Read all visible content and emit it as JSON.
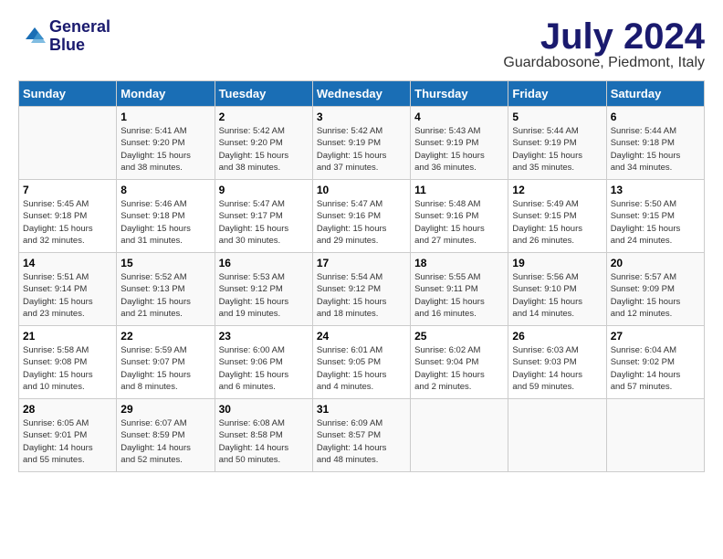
{
  "header": {
    "logo_line1": "General",
    "logo_line2": "Blue",
    "month_year": "July 2024",
    "location": "Guardabosone, Piedmont, Italy"
  },
  "days_of_week": [
    "Sunday",
    "Monday",
    "Tuesday",
    "Wednesday",
    "Thursday",
    "Friday",
    "Saturday"
  ],
  "weeks": [
    [
      {
        "day": "",
        "info": ""
      },
      {
        "day": "1",
        "info": "Sunrise: 5:41 AM\nSunset: 9:20 PM\nDaylight: 15 hours\nand 38 minutes."
      },
      {
        "day": "2",
        "info": "Sunrise: 5:42 AM\nSunset: 9:20 PM\nDaylight: 15 hours\nand 38 minutes."
      },
      {
        "day": "3",
        "info": "Sunrise: 5:42 AM\nSunset: 9:19 PM\nDaylight: 15 hours\nand 37 minutes."
      },
      {
        "day": "4",
        "info": "Sunrise: 5:43 AM\nSunset: 9:19 PM\nDaylight: 15 hours\nand 36 minutes."
      },
      {
        "day": "5",
        "info": "Sunrise: 5:44 AM\nSunset: 9:19 PM\nDaylight: 15 hours\nand 35 minutes."
      },
      {
        "day": "6",
        "info": "Sunrise: 5:44 AM\nSunset: 9:18 PM\nDaylight: 15 hours\nand 34 minutes."
      }
    ],
    [
      {
        "day": "7",
        "info": "Sunrise: 5:45 AM\nSunset: 9:18 PM\nDaylight: 15 hours\nand 32 minutes."
      },
      {
        "day": "8",
        "info": "Sunrise: 5:46 AM\nSunset: 9:18 PM\nDaylight: 15 hours\nand 31 minutes."
      },
      {
        "day": "9",
        "info": "Sunrise: 5:47 AM\nSunset: 9:17 PM\nDaylight: 15 hours\nand 30 minutes."
      },
      {
        "day": "10",
        "info": "Sunrise: 5:47 AM\nSunset: 9:16 PM\nDaylight: 15 hours\nand 29 minutes."
      },
      {
        "day": "11",
        "info": "Sunrise: 5:48 AM\nSunset: 9:16 PM\nDaylight: 15 hours\nand 27 minutes."
      },
      {
        "day": "12",
        "info": "Sunrise: 5:49 AM\nSunset: 9:15 PM\nDaylight: 15 hours\nand 26 minutes."
      },
      {
        "day": "13",
        "info": "Sunrise: 5:50 AM\nSunset: 9:15 PM\nDaylight: 15 hours\nand 24 minutes."
      }
    ],
    [
      {
        "day": "14",
        "info": "Sunrise: 5:51 AM\nSunset: 9:14 PM\nDaylight: 15 hours\nand 23 minutes."
      },
      {
        "day": "15",
        "info": "Sunrise: 5:52 AM\nSunset: 9:13 PM\nDaylight: 15 hours\nand 21 minutes."
      },
      {
        "day": "16",
        "info": "Sunrise: 5:53 AM\nSunset: 9:12 PM\nDaylight: 15 hours\nand 19 minutes."
      },
      {
        "day": "17",
        "info": "Sunrise: 5:54 AM\nSunset: 9:12 PM\nDaylight: 15 hours\nand 18 minutes."
      },
      {
        "day": "18",
        "info": "Sunrise: 5:55 AM\nSunset: 9:11 PM\nDaylight: 15 hours\nand 16 minutes."
      },
      {
        "day": "19",
        "info": "Sunrise: 5:56 AM\nSunset: 9:10 PM\nDaylight: 15 hours\nand 14 minutes."
      },
      {
        "day": "20",
        "info": "Sunrise: 5:57 AM\nSunset: 9:09 PM\nDaylight: 15 hours\nand 12 minutes."
      }
    ],
    [
      {
        "day": "21",
        "info": "Sunrise: 5:58 AM\nSunset: 9:08 PM\nDaylight: 15 hours\nand 10 minutes."
      },
      {
        "day": "22",
        "info": "Sunrise: 5:59 AM\nSunset: 9:07 PM\nDaylight: 15 hours\nand 8 minutes."
      },
      {
        "day": "23",
        "info": "Sunrise: 6:00 AM\nSunset: 9:06 PM\nDaylight: 15 hours\nand 6 minutes."
      },
      {
        "day": "24",
        "info": "Sunrise: 6:01 AM\nSunset: 9:05 PM\nDaylight: 15 hours\nand 4 minutes."
      },
      {
        "day": "25",
        "info": "Sunrise: 6:02 AM\nSunset: 9:04 PM\nDaylight: 15 hours\nand 2 minutes."
      },
      {
        "day": "26",
        "info": "Sunrise: 6:03 AM\nSunset: 9:03 PM\nDaylight: 14 hours\nand 59 minutes."
      },
      {
        "day": "27",
        "info": "Sunrise: 6:04 AM\nSunset: 9:02 PM\nDaylight: 14 hours\nand 57 minutes."
      }
    ],
    [
      {
        "day": "28",
        "info": "Sunrise: 6:05 AM\nSunset: 9:01 PM\nDaylight: 14 hours\nand 55 minutes."
      },
      {
        "day": "29",
        "info": "Sunrise: 6:07 AM\nSunset: 8:59 PM\nDaylight: 14 hours\nand 52 minutes."
      },
      {
        "day": "30",
        "info": "Sunrise: 6:08 AM\nSunset: 8:58 PM\nDaylight: 14 hours\nand 50 minutes."
      },
      {
        "day": "31",
        "info": "Sunrise: 6:09 AM\nSunset: 8:57 PM\nDaylight: 14 hours\nand 48 minutes."
      },
      {
        "day": "",
        "info": ""
      },
      {
        "day": "",
        "info": ""
      },
      {
        "day": "",
        "info": ""
      }
    ]
  ]
}
